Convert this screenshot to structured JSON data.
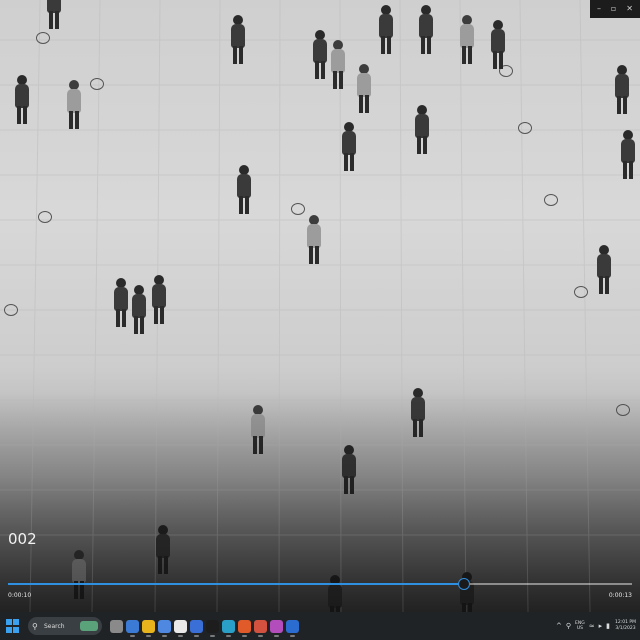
{
  "window": {
    "minimize_icon": "–",
    "restore_icon": "▫",
    "close_icon": "✕"
  },
  "player": {
    "title": "002",
    "current_time": "0:00:10",
    "total_time": "0:00:13",
    "progress_fraction": 0.73
  },
  "taskbar": {
    "search_label": "Search",
    "language_line1": "ENG",
    "language_line2": "US",
    "clock_time": "12:01 PM",
    "clock_date": "3/1/2023",
    "app_colors": [
      "#8a8a8a",
      "#3b7bd6",
      "#e8b41e",
      "#4f88e0",
      "#e9e9e9",
      "#3a6fd8",
      "#1d1d1d",
      "#2aa0c8",
      "#e05a2a",
      "#d2513f",
      "#b34dbb",
      "#2b6cd0"
    ]
  }
}
